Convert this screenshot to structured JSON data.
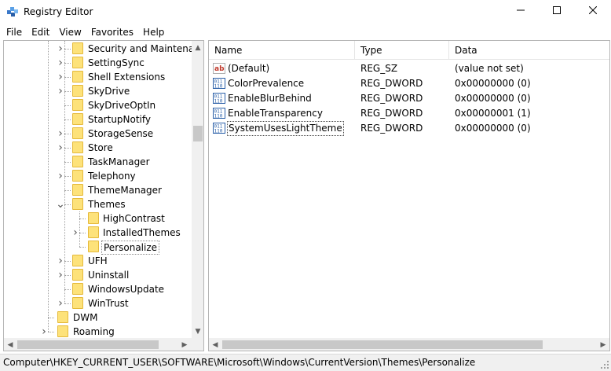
{
  "window": {
    "title": "Registry Editor",
    "controls": {
      "minimize": "—",
      "maximize": "☐",
      "close": "✕"
    }
  },
  "menu": [
    "File",
    "Edit",
    "View",
    "Favorites",
    "Help"
  ],
  "tree": {
    "items": [
      {
        "label": "Security and Maintenanc",
        "expander": "collapsed",
        "level": 3
      },
      {
        "label": "SettingSync",
        "expander": "collapsed",
        "level": 3
      },
      {
        "label": "Shell Extensions",
        "expander": "collapsed",
        "level": 3
      },
      {
        "label": "SkyDrive",
        "expander": "collapsed",
        "level": 3
      },
      {
        "label": "SkyDriveOptIn",
        "expander": "none",
        "level": 3
      },
      {
        "label": "StartupNotify",
        "expander": "none",
        "level": 3
      },
      {
        "label": "StorageSense",
        "expander": "collapsed",
        "level": 3
      },
      {
        "label": "Store",
        "expander": "collapsed",
        "level": 3
      },
      {
        "label": "TaskManager",
        "expander": "none",
        "level": 3
      },
      {
        "label": "Telephony",
        "expander": "collapsed",
        "level": 3
      },
      {
        "label": "ThemeManager",
        "expander": "none",
        "level": 3
      },
      {
        "label": "Themes",
        "expander": "expanded",
        "level": 3
      },
      {
        "label": "HighContrast",
        "expander": "none",
        "level": 4
      },
      {
        "label": "InstalledThemes",
        "expander": "collapsed",
        "level": 4
      },
      {
        "label": "Personalize",
        "expander": "none",
        "level": 4,
        "selected": true
      },
      {
        "label": "UFH",
        "expander": "collapsed",
        "level": 3
      },
      {
        "label": "Uninstall",
        "expander": "collapsed",
        "level": 3
      },
      {
        "label": "WindowsUpdate",
        "expander": "none",
        "level": 3
      },
      {
        "label": "WinTrust",
        "expander": "collapsed",
        "level": 3
      },
      {
        "label": "DWM",
        "expander": "none",
        "level": 2
      },
      {
        "label": "Roaming",
        "expander": "collapsed",
        "level": 2
      }
    ]
  },
  "values": {
    "columns": {
      "name": "Name",
      "type": "Type",
      "data": "Data"
    },
    "rows": [
      {
        "name": "(Default)",
        "type": "REG_SZ",
        "data": "(value not set)",
        "icon": "string-value-icon"
      },
      {
        "name": "ColorPrevalence",
        "type": "REG_DWORD",
        "data": "0x00000000 (0)",
        "icon": "binary-value-icon"
      },
      {
        "name": "EnableBlurBehind",
        "type": "REG_DWORD",
        "data": "0x00000000 (0)",
        "icon": "binary-value-icon"
      },
      {
        "name": "EnableTransparency",
        "type": "REG_DWORD",
        "data": "0x00000001 (1)",
        "icon": "binary-value-icon"
      },
      {
        "name": "SystemUsesLightTheme",
        "type": "REG_DWORD",
        "data": "0x00000000 (0)",
        "icon": "binary-value-icon",
        "focused": true
      }
    ]
  },
  "status": {
    "path": "Computer\\HKEY_CURRENT_USER\\SOFTWARE\\Microsoft\\Windows\\CurrentVersion\\Themes\\Personalize"
  }
}
